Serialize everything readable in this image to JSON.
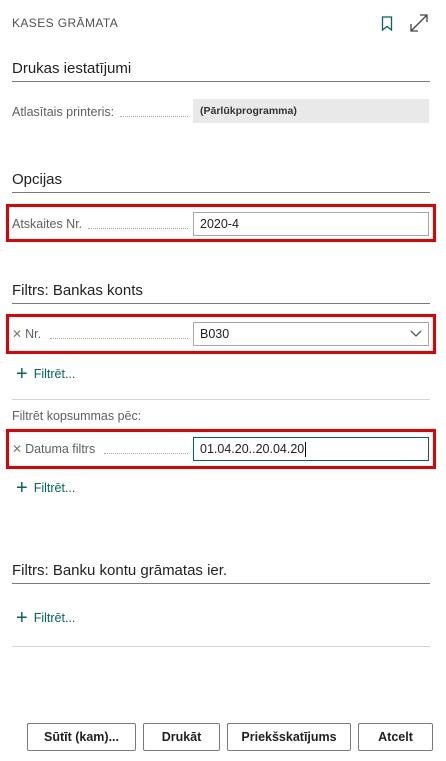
{
  "dialog": {
    "title": "KASES GRĀMATA"
  },
  "header": {
    "bookmark_icon": "bookmark-icon",
    "expand_icon": "expand-icon"
  },
  "print_settings": {
    "title": "Drukas iestatījumi",
    "printer_label": "Atlasītais printeris:",
    "printer_value": "(Pārlūkprogramma)"
  },
  "options": {
    "title": "Opcijas",
    "report_no_label": "Atskaites Nr.",
    "report_no_value": "2020-4"
  },
  "filter_bank": {
    "title": "Filtrs: Bankas konts",
    "no_label": "Nr.",
    "no_value": "B030",
    "add_filter": "Filtrēt...",
    "totals_header": "Filtrēt kopsummas pēc:",
    "date_label": "Datuma filtrs",
    "date_value": "01.04.20..20.04.20",
    "add_filter2": "Filtrēt..."
  },
  "filter_ledger": {
    "title": "Filtrs: Banku kontu grāmatas ier.",
    "add_filter": "Filtrēt..."
  },
  "buttons": {
    "send": "Sūtīt (kam)...",
    "print": "Drukāt",
    "preview": "Priekšskatījums",
    "cancel": "Atcelt"
  },
  "colors": {
    "accent": "#00665f",
    "highlight": "#e30000"
  }
}
